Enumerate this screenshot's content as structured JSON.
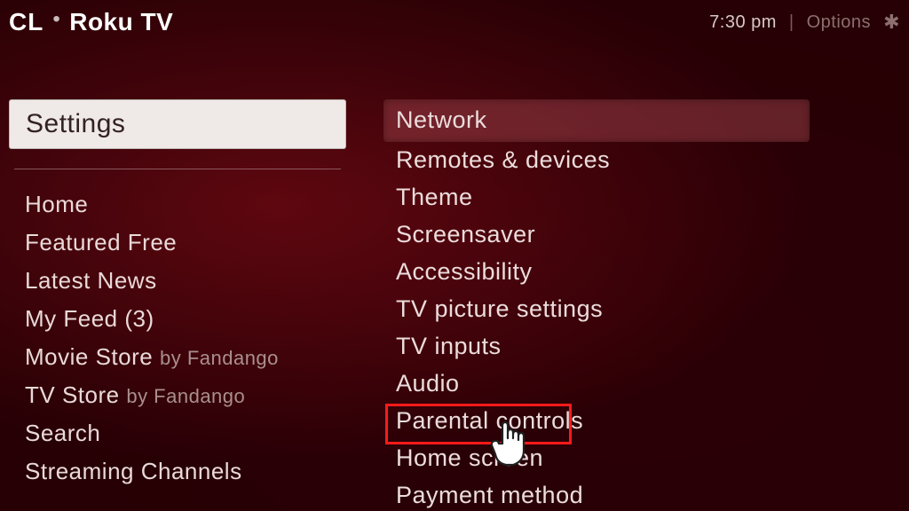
{
  "header": {
    "brand_prefix": "CL",
    "brand_main": "Roku TV",
    "time": "7:30 pm",
    "options_label": "Options"
  },
  "left": {
    "title": "Settings",
    "items": [
      {
        "label": "Home"
      },
      {
        "label": "Featured Free"
      },
      {
        "label": "Latest News"
      },
      {
        "label": "My Feed (3)"
      },
      {
        "label": "Movie Store",
        "suffix": "by Fandango"
      },
      {
        "label": "TV Store",
        "suffix": "by Fandango"
      },
      {
        "label": "Search"
      },
      {
        "label": "Streaming Channels"
      }
    ]
  },
  "right": {
    "items": [
      {
        "label": "Network",
        "selected": true
      },
      {
        "label": "Remotes & devices"
      },
      {
        "label": "Theme"
      },
      {
        "label": "Screensaver"
      },
      {
        "label": "Accessibility"
      },
      {
        "label": "TV picture settings"
      },
      {
        "label": "TV inputs"
      },
      {
        "label": "Audio"
      },
      {
        "label": "Parental controls",
        "highlighted": true
      },
      {
        "label": "Home screen"
      },
      {
        "label": "Payment method"
      }
    ]
  },
  "annotation": {
    "cursor_target": "Parental controls"
  }
}
